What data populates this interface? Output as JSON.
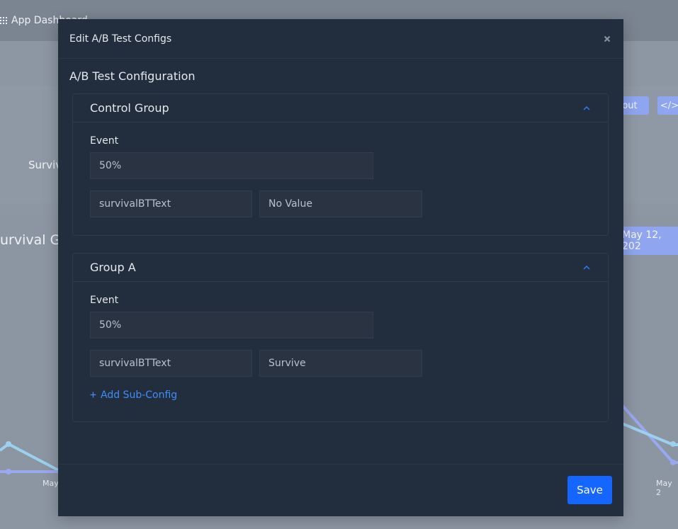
{
  "background": {
    "app_title": "App Dashboard",
    "survival_label": "Surviv",
    "chart_title": "urvival Go",
    "button_out": "out",
    "button_code": "</>",
    "date_label": "May 12, 202",
    "axis_left": "May",
    "axis_right": "May 2"
  },
  "modal": {
    "title": "Edit A/B Test Configs",
    "close_icon": "close-icon",
    "section_title": "A/B Test Configuration",
    "groups": [
      {
        "title": "Control Group",
        "event_label": "Event",
        "event_value": "50%",
        "config_key": "survivalBTText",
        "config_value": "No Value"
      },
      {
        "title": "Group A",
        "event_label": "Event",
        "event_value": "50%",
        "config_key": "survivalBTText",
        "config_value": "Survive",
        "add_sub_config": "Add Sub-Config"
      }
    ],
    "save_label": "Save"
  },
  "colors": {
    "modal_bg": "#222d3d",
    "accent": "#1565ff",
    "link": "#3f8ef7",
    "input_bg": "#2a3342"
  }
}
